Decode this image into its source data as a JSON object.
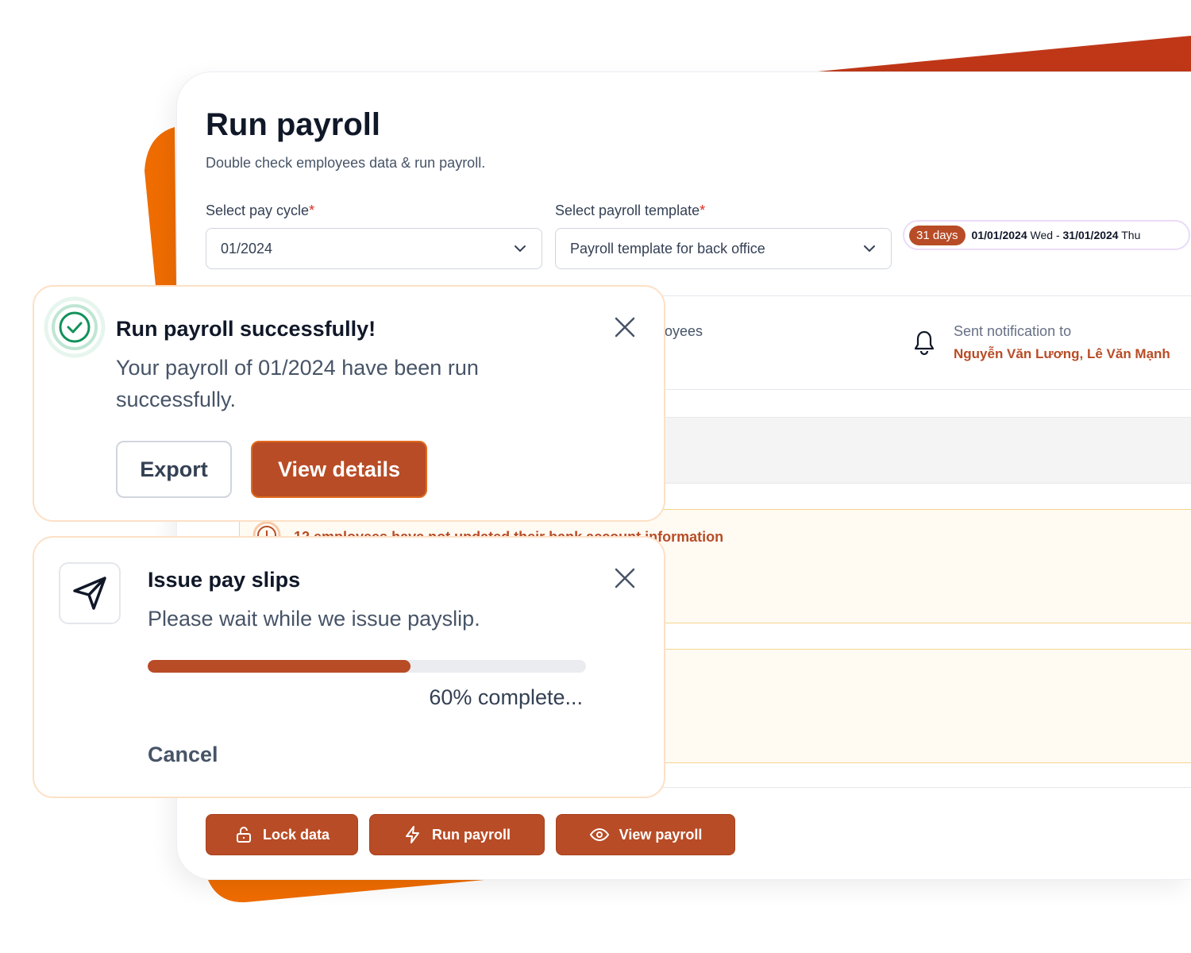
{
  "page": {
    "title": "Run payroll",
    "subtitle": "Double check employees data & run payroll.",
    "pay_cycle": {
      "label": "Select pay cycle",
      "required_mark": "*",
      "value": "01/2024"
    },
    "payroll_template": {
      "label": "Select payroll template",
      "required_mark": "*",
      "value": "Payroll template for back office"
    },
    "date_range": {
      "days": "31 days",
      "start_date": "01/01/2024",
      "start_day": "Wed",
      "separator": "-",
      "end_date": "31/01/2024",
      "end_day": "Thu"
    },
    "employees_label_partial": "oyees",
    "notification": {
      "label": "Sent notification to",
      "recipients": "Nguyễn Văn Lương, Lê Văn Mạnh"
    },
    "warning": "12 employees have not updated their bank account information",
    "actions": {
      "lock": "Lock data",
      "run": "Run payroll",
      "view": "View payroll"
    }
  },
  "toast_success": {
    "title": "Run payroll successfully!",
    "message": "Your payroll of 01/2024 have been run successfully.",
    "export": "Export",
    "view_details": "View details"
  },
  "toast_progress": {
    "title": "Issue pay slips",
    "message": "Please wait while we issue payslip.",
    "progress_percent": 60,
    "progress_text": "60% complete...",
    "cancel": "Cancel"
  },
  "colors": {
    "accent": "#b84c26",
    "orange": "#ef6c00",
    "success": "#12915a"
  }
}
